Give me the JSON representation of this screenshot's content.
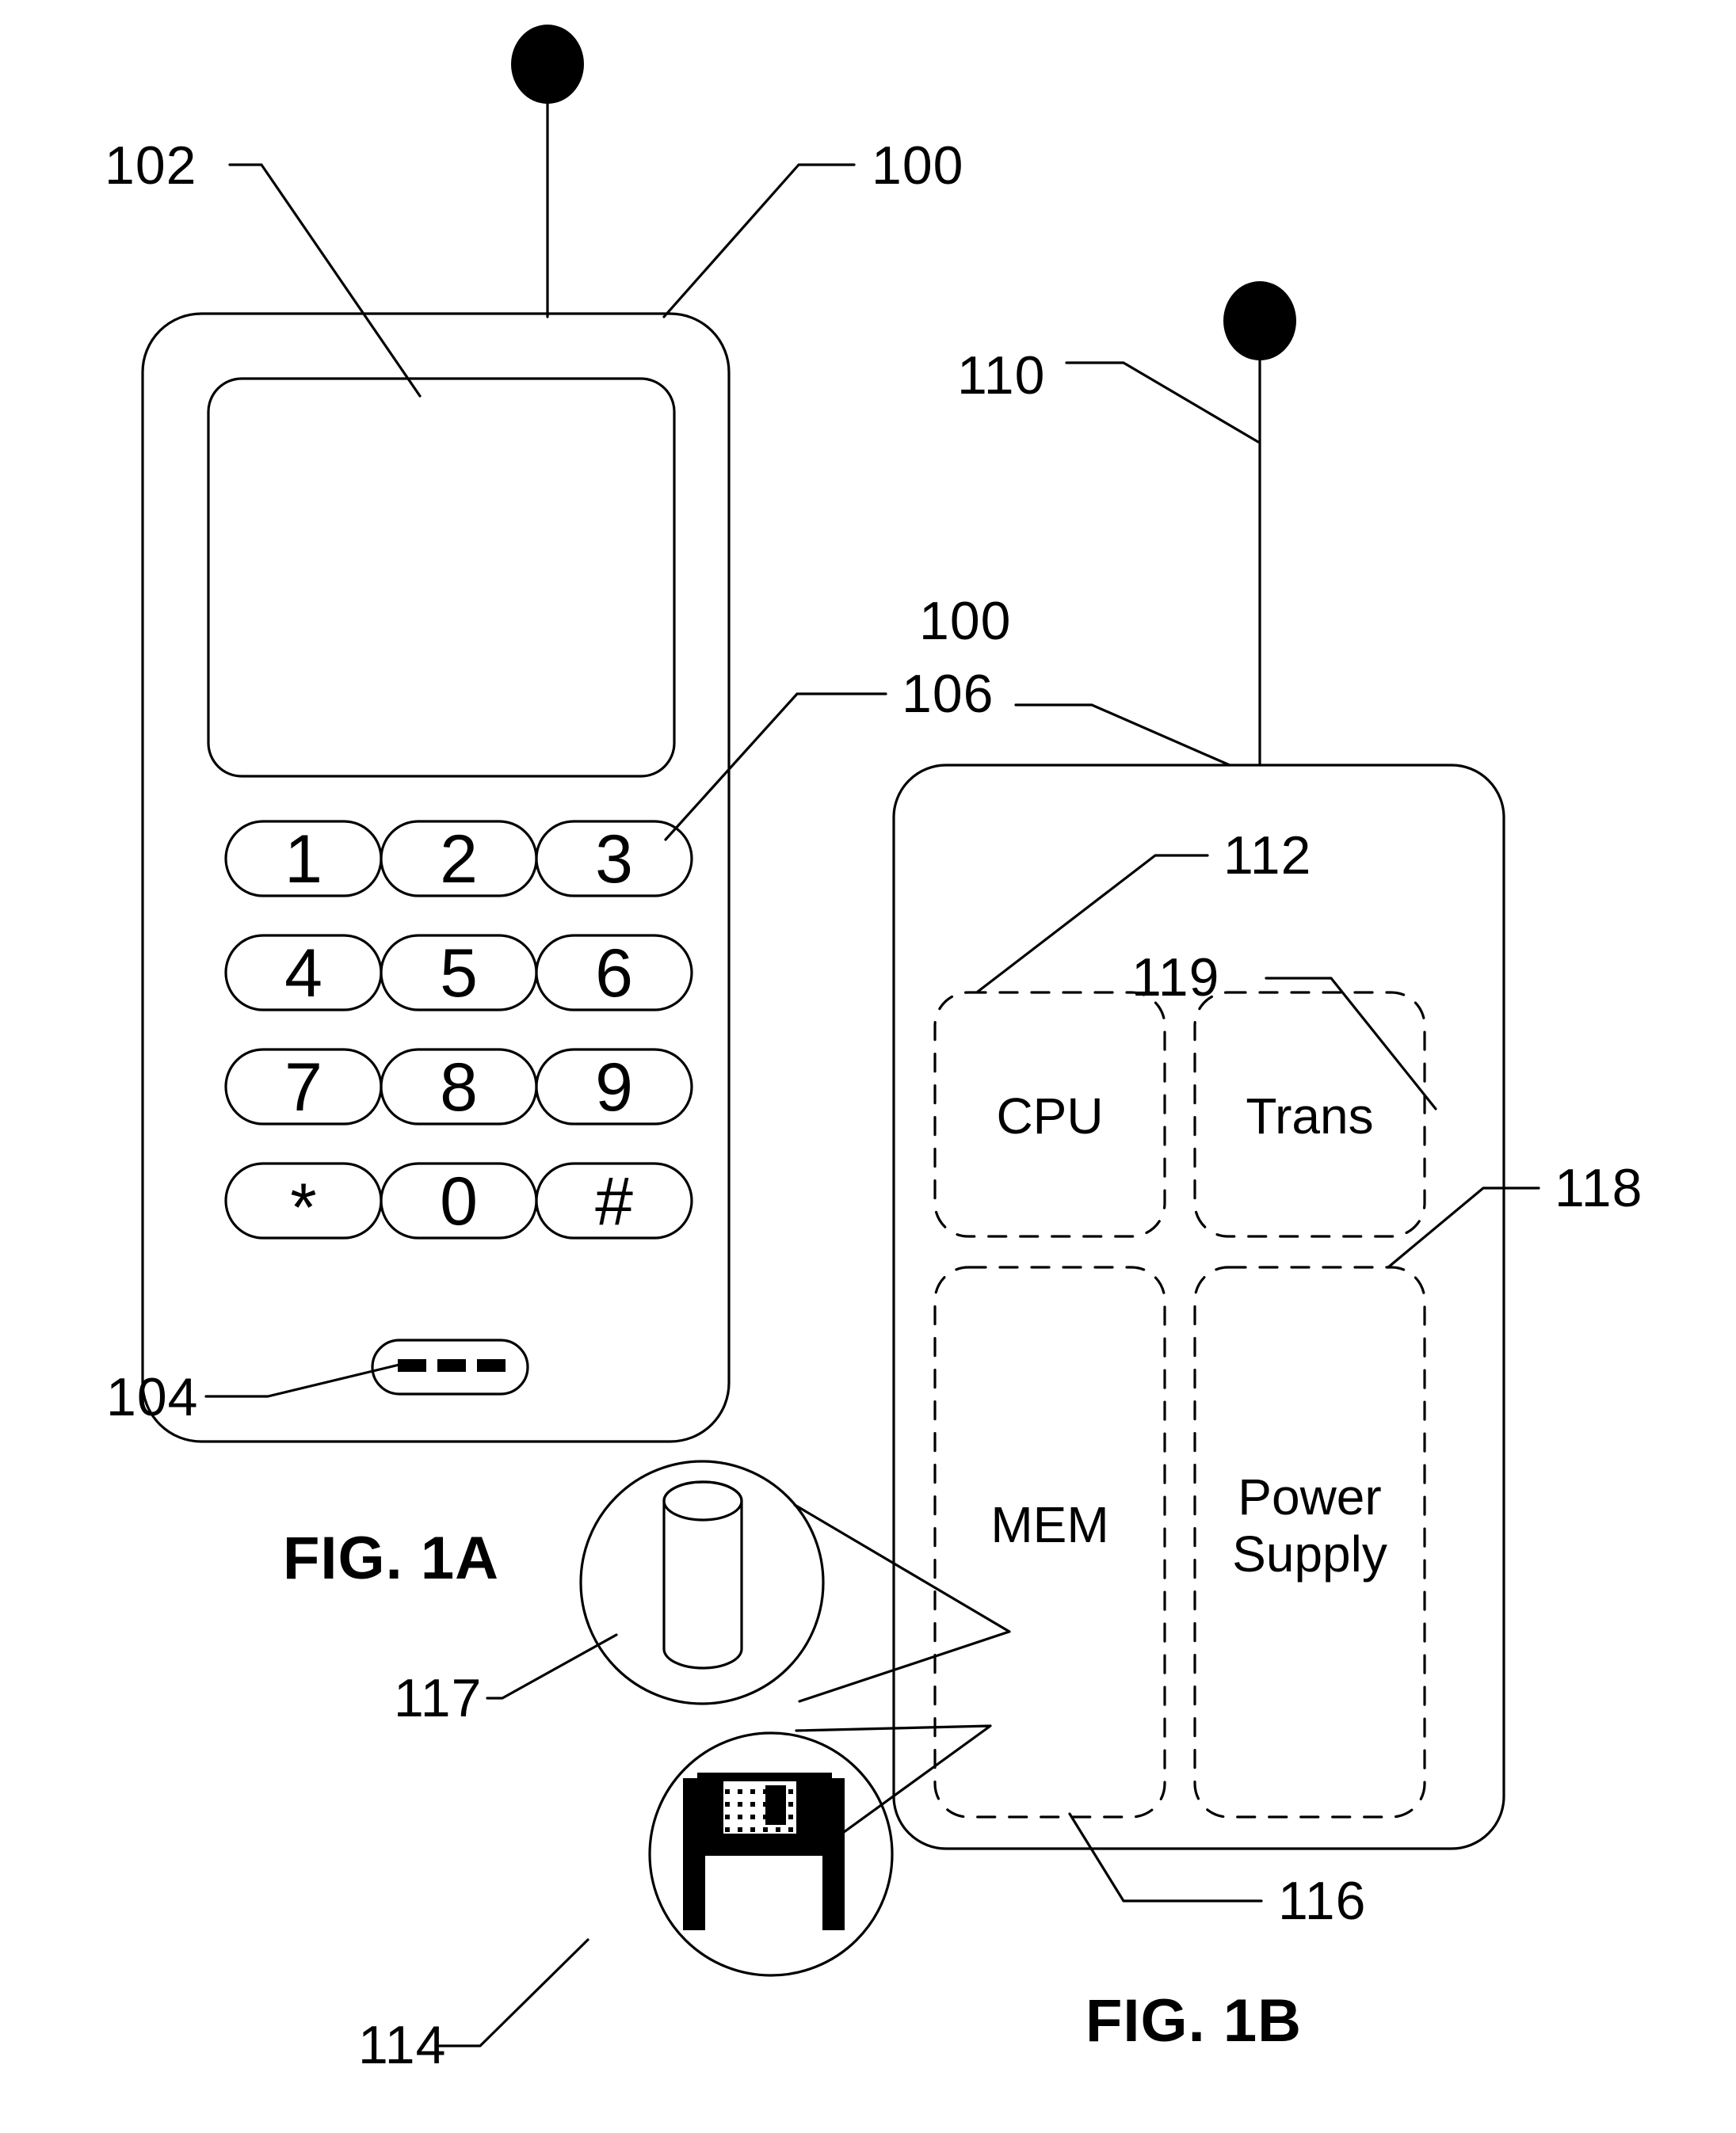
{
  "figures": [
    {
      "id": "fig1a",
      "caption": "FIG. 1A"
    },
    {
      "id": "fig1b",
      "caption": "FIG. 1B"
    }
  ],
  "fig1a": {
    "caption": "FIG. 1A",
    "reference_numerals": [
      {
        "id": "100",
        "text": "100",
        "target": "handset-body"
      },
      {
        "id": "102",
        "text": "102",
        "target": "display-screen"
      },
      {
        "id": "104",
        "text": "104",
        "target": "function-bar-key"
      },
      {
        "id": "106",
        "text": "106",
        "target": "keypad-key-3"
      }
    ],
    "antenna": {
      "name": "antenna",
      "tip": "antenna-ball"
    },
    "keypad": {
      "rows": [
        [
          "1",
          "2",
          "3"
        ],
        [
          "4",
          "5",
          "6"
        ],
        [
          "7",
          "8",
          "9"
        ],
        [
          "*",
          "0",
          "#"
        ]
      ],
      "function_bar": "---"
    }
  },
  "fig1b": {
    "caption": "FIG. 1B",
    "reference_numerals": [
      {
        "id": "110",
        "text": "110",
        "target": "antenna-ball"
      },
      {
        "id": "100",
        "text": "100",
        "target": "handset-body"
      },
      {
        "id": "112",
        "text": "112",
        "target": "cpu-block"
      },
      {
        "id": "119",
        "text": "119",
        "target": "trans-block"
      },
      {
        "id": "118",
        "text": "118",
        "target": "power-supply-block"
      },
      {
        "id": "116",
        "text": "116",
        "target": "mem-block"
      },
      {
        "id": "117",
        "text": "117",
        "target": "database-cylinder-callout"
      },
      {
        "id": "114",
        "text": "114",
        "target": "floppy-disk-callout"
      }
    ],
    "blocks": [
      {
        "id": "cpu",
        "label": "CPU",
        "lines": [
          "CPU"
        ]
      },
      {
        "id": "trans",
        "label": "Trans",
        "lines": [
          "Trans"
        ]
      },
      {
        "id": "mem",
        "label": "MEM",
        "lines": [
          "MEM"
        ]
      },
      {
        "id": "power_supply",
        "label": "Power Supply",
        "lines": [
          "Power",
          "Supply"
        ]
      }
    ],
    "callouts": [
      {
        "id": "callout-117",
        "numeral": "117",
        "icon": "database-cylinder-icon"
      },
      {
        "id": "callout-114",
        "numeral": "114",
        "icon": "floppy-disk-icon"
      }
    ]
  },
  "colors": {
    "ink": "#000000",
    "paper": "#ffffff"
  }
}
